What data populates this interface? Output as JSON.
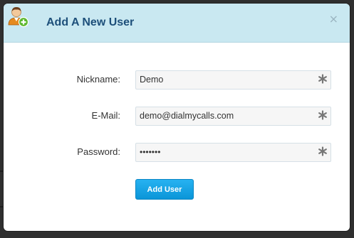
{
  "modal": {
    "title": "Add A New User",
    "close_label": "×"
  },
  "form": {
    "fields": [
      {
        "label": "Nickname:",
        "value": "Demo",
        "type": "text"
      },
      {
        "label": "E-Mail:",
        "value": "demo@dialmycalls.com",
        "type": "text"
      },
      {
        "label": "Password:",
        "value": "•••••••",
        "type": "password"
      }
    ],
    "required_icon": "asterisk-icon",
    "submit_label": "Add User"
  },
  "colors": {
    "header_bg": "#c9e8f1",
    "title_color": "#1d4f7a",
    "button_bg": "#0a95d8",
    "field_bg": "#f6f6f6"
  }
}
